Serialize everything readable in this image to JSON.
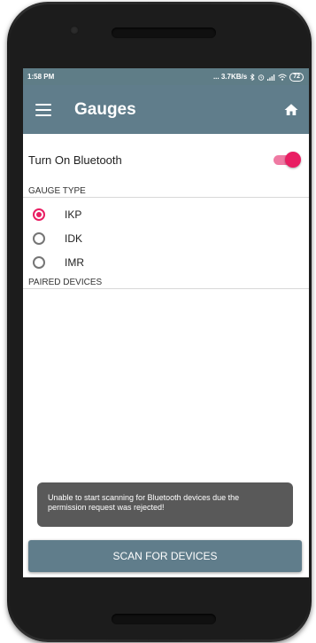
{
  "status_bar": {
    "time": "1:58 PM",
    "right_text": "... 3.7KB/s",
    "icons": [
      "bluetooth-icon",
      "alarm-icon",
      "signal-icon",
      "wifi-icon"
    ],
    "battery": "72"
  },
  "app_bar": {
    "title": "Gauges",
    "menu_icon": "menu-icon",
    "home_icon": "home-icon"
  },
  "bluetooth": {
    "label": "Turn On Bluetooth",
    "enabled": true
  },
  "gauge_type": {
    "header": "GAUGE TYPE",
    "options": [
      {
        "label": "IKP",
        "selected": true
      },
      {
        "label": "IDK",
        "selected": false
      },
      {
        "label": "IMR",
        "selected": false
      }
    ]
  },
  "paired_devices": {
    "header": "PAIRED DEVICES"
  },
  "toast": {
    "message": "Unable to start scanning for Bluetooth devices due the permission request was rejected!"
  },
  "scan_button": {
    "label": "SCAN FOR DEVICES"
  },
  "colors": {
    "primary": "#607d8b",
    "accent": "#e91e63",
    "toast_bg": "#595959"
  }
}
